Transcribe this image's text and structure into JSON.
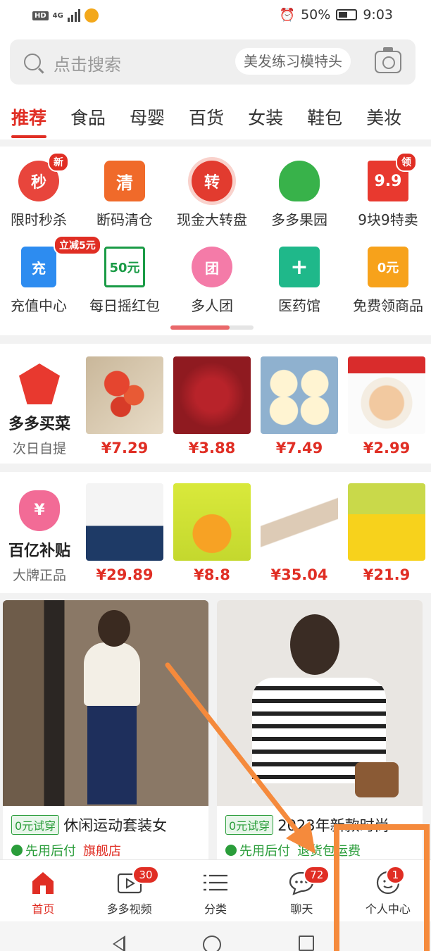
{
  "status": {
    "signal": "4G",
    "battery": "50%",
    "time": "9:03"
  },
  "search": {
    "placeholder": "点击搜索",
    "suggestion": "美发练习模特头"
  },
  "categories": [
    "推荐",
    "食品",
    "母婴",
    "百货",
    "女装",
    "鞋包",
    "美妆"
  ],
  "grid": {
    "items": [
      {
        "label": "限时秒杀",
        "icon_text": "秒",
        "badge": "新"
      },
      {
        "label": "断码清仓",
        "icon_text": "清"
      },
      {
        "label": "现金大转盘",
        "icon_text": "转"
      },
      {
        "label": "多多果园"
      },
      {
        "label": "9块9特卖",
        "icon_text": "9.9",
        "badge": "领"
      },
      {
        "label": "充值中心",
        "icon_text": "充",
        "badge": "立减5元"
      },
      {
        "label": "每日摇红包",
        "icon_text": "50元"
      },
      {
        "label": "多人团",
        "icon_text": "团"
      },
      {
        "label": "医药馆",
        "icon_text": "+"
      },
      {
        "label": "免费领商品",
        "icon_text": "0元"
      }
    ],
    "scroll_progress": 0.71
  },
  "row1": {
    "title": "多多买菜",
    "sub": "次日自提",
    "products": [
      {
        "price": "¥7.29"
      },
      {
        "price": "¥3.88"
      },
      {
        "price": "¥7.49"
      },
      {
        "price": "¥2.99"
      }
    ]
  },
  "row2": {
    "title": "百亿补贴",
    "sub": "大牌正品",
    "products": [
      {
        "price": "¥29.89"
      },
      {
        "price": "¥8.8"
      },
      {
        "price": "¥35.04"
      },
      {
        "price": "¥21.9"
      }
    ]
  },
  "feed": [
    {
      "trial": "0元试穿",
      "title": "休闲运动套装女",
      "tag1": "先用后付",
      "tag2": "旗舰店"
    },
    {
      "trial": "0元试穿",
      "title": "2023年新款时尚",
      "tag1": "先用后付",
      "tag2": "退货包运费"
    }
  ],
  "nav": {
    "items": [
      {
        "label": "首页"
      },
      {
        "label": "多多视频",
        "badge": "30"
      },
      {
        "label": "分类"
      },
      {
        "label": "聊天",
        "badge": "72"
      },
      {
        "label": "个人中心",
        "badge": "1"
      }
    ]
  },
  "colors": {
    "brand": "#e02e24",
    "annotation": "#f58a3c",
    "accent_green": "#2a9d3a"
  }
}
